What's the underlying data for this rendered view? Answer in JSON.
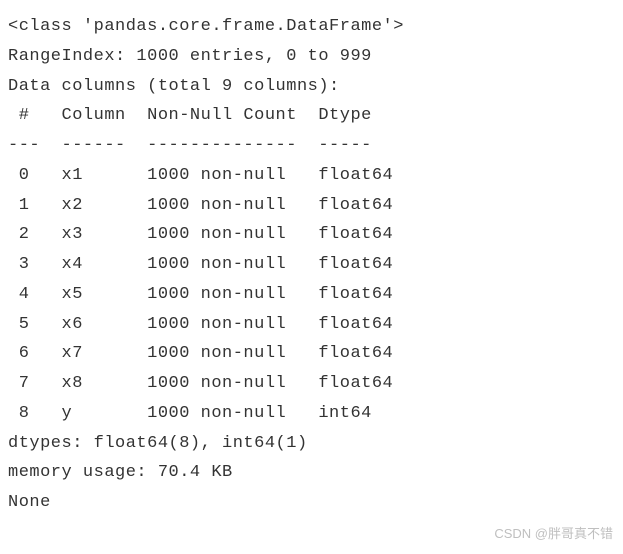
{
  "header": {
    "class_line": "<class 'pandas.core.frame.DataFrame'>",
    "range_index": "RangeIndex: 1000 entries, 0 to 999",
    "data_columns_intro": "Data columns (total 9 columns):",
    "col_header": " #   Column  Non-Null Count  Dtype  ",
    "divider": "---  ------  --------------  -----  "
  },
  "columns": [
    {
      "row": " 0   x1      1000 non-null   float64"
    },
    {
      "row": " 1   x2      1000 non-null   float64"
    },
    {
      "row": " 2   x3      1000 non-null   float64"
    },
    {
      "row": " 3   x4      1000 non-null   float64"
    },
    {
      "row": " 4   x5      1000 non-null   float64"
    },
    {
      "row": " 5   x6      1000 non-null   float64"
    },
    {
      "row": " 6   x7      1000 non-null   float64"
    },
    {
      "row": " 7   x8      1000 non-null   float64"
    },
    {
      "row": " 8   y       1000 non-null   int64  "
    }
  ],
  "footer": {
    "dtypes": "dtypes: float64(8), int64(1)",
    "memory": "memory usage: 70.4 KB",
    "none": "None"
  },
  "watermark": "CSDN @胖哥真不错"
}
